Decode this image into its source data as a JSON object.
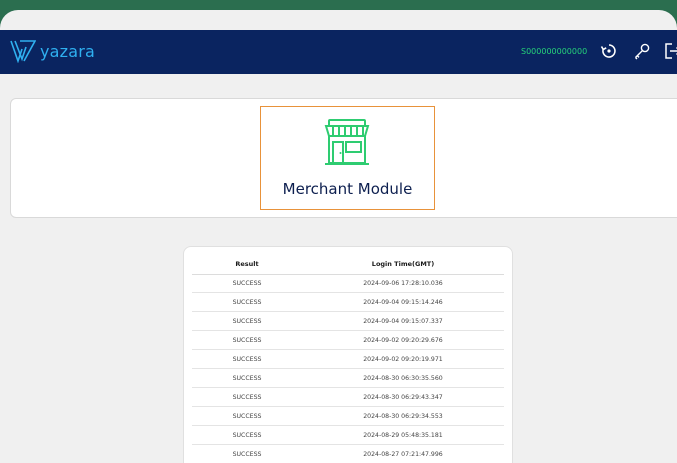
{
  "header": {
    "brand": "yazara",
    "merchant_id": "S000000000000",
    "icons": [
      "refresh-icon",
      "key-icon",
      "logout-icon"
    ]
  },
  "module": {
    "label": "Merchant Module",
    "icon": "store-icon"
  },
  "table": {
    "columns": [
      "Result",
      "Login Time(GMT)"
    ],
    "rows": [
      {
        "result": "SUCCESS",
        "time": "2024-09-06 17:28:10.036"
      },
      {
        "result": "SUCCESS",
        "time": "2024-09-04 09:15:14.246"
      },
      {
        "result": "SUCCESS",
        "time": "2024-09-04 09:15:07.337"
      },
      {
        "result": "SUCCESS",
        "time": "2024-09-02 09:20:29.676"
      },
      {
        "result": "SUCCESS",
        "time": "2024-09-02 09:20:19.971"
      },
      {
        "result": "SUCCESS",
        "time": "2024-08-30 06:30:35.560"
      },
      {
        "result": "SUCCESS",
        "time": "2024-08-30 06:29:43.347"
      },
      {
        "result": "SUCCESS",
        "time": "2024-08-30 06:29:34.553"
      },
      {
        "result": "SUCCESS",
        "time": "2024-08-29 05:48:35.181"
      },
      {
        "result": "SUCCESS",
        "time": "2024-08-27 07:21:47.996"
      }
    ]
  },
  "colors": {
    "header_bg": "#0a2460",
    "brand": "#2fb0f0",
    "merchant_id": "#25d27a",
    "tile_border": "#e8923a",
    "store_icon": "#2ecc71",
    "backdrop": "#2b6e4f"
  }
}
